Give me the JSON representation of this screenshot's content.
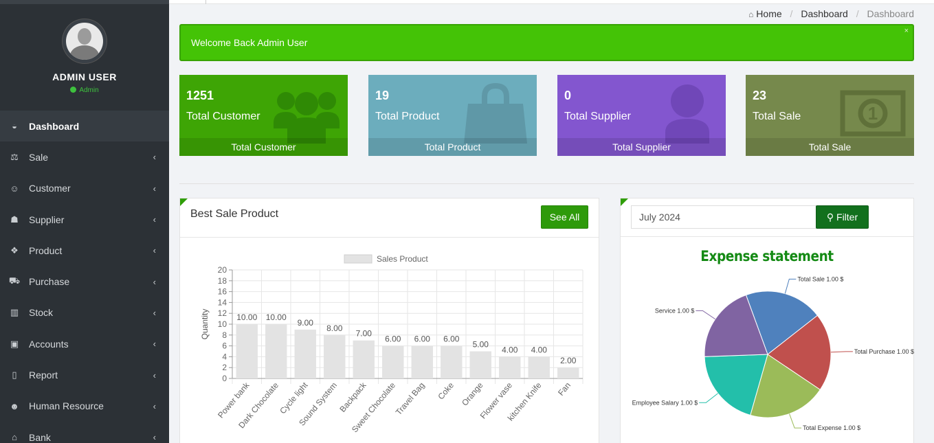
{
  "user": {
    "name": "ADMIN USER",
    "role": "Admin"
  },
  "menu": [
    {
      "label": "Dashboard",
      "icon": "dashboard-icon",
      "glyph": "◒"
    },
    {
      "label": "Sale",
      "icon": "balance-scale-icon",
      "glyph": "⚖"
    },
    {
      "label": "Customer",
      "icon": "user-circle-icon",
      "glyph": "☺"
    },
    {
      "label": "Supplier",
      "icon": "supplier-icon",
      "glyph": "☗"
    },
    {
      "label": "Product",
      "icon": "cubes-icon",
      "glyph": "❖"
    },
    {
      "label": "Purchase",
      "icon": "cart-icon",
      "glyph": "⛟"
    },
    {
      "label": "Stock",
      "icon": "bar-chart-icon",
      "glyph": "▥"
    },
    {
      "label": "Accounts",
      "icon": "money-icon",
      "glyph": "▣"
    },
    {
      "label": "Report",
      "icon": "book-icon",
      "glyph": "▯"
    },
    {
      "label": "Human Resource",
      "icon": "users-icon",
      "glyph": "☻"
    },
    {
      "label": "Bank",
      "icon": "bank-icon",
      "glyph": "⌂"
    }
  ],
  "breadcrumb": {
    "home": "Home",
    "parent": "Dashboard",
    "current": "Dashboard"
  },
  "alert": {
    "text": "Welcome Back Admin User",
    "close": "×"
  },
  "cards": [
    {
      "value": "1251",
      "label": "Total Customer",
      "footer": "Total Customer",
      "icon": "users-icon"
    },
    {
      "value": "19",
      "label": "Total Product",
      "footer": "Total Product",
      "icon": "shopping-bag-icon"
    },
    {
      "value": "0",
      "label": "Total Supplier",
      "footer": "Total Supplier",
      "icon": "user-icon"
    },
    {
      "value": "23",
      "label": "Total Sale",
      "footer": "Total Sale",
      "icon": "money-bill-icon"
    }
  ],
  "best_sale": {
    "title": "Best Sale Product",
    "button": "See All"
  },
  "expense": {
    "month": "July 2024",
    "filter": "Filter",
    "title": "Expense statement"
  },
  "chart_data": [
    {
      "type": "bar",
      "legend": [
        "Sales Product"
      ],
      "ylabel": "Quantity",
      "ylim": [
        0,
        20
      ],
      "yticks": [
        0,
        2,
        4,
        6,
        8,
        10,
        12,
        14,
        16,
        18,
        20
      ],
      "categories": [
        "Power bank",
        "Dark Chocolate",
        "Cycle light",
        "Sound System",
        "Backpack",
        "Sweet Chocolate",
        "Travel Bag",
        "Coke",
        "Orange",
        "Flower vase",
        "kitchen Knife",
        "Fan"
      ],
      "values": [
        10,
        10,
        9,
        8,
        7,
        6,
        6,
        6,
        5,
        4,
        4,
        2
      ],
      "data_labels": [
        "10.00",
        "10.00",
        "9.00",
        "8.00",
        "7.00",
        "6.00",
        "6.00",
        "6.00",
        "5.00",
        "4.00",
        "4.00",
        "2.00"
      ],
      "color": "#e3e3e3"
    },
    {
      "type": "pie",
      "title": "Expense statement",
      "slices": [
        {
          "label": "Total Sale 1.00 $",
          "value": 1,
          "color": "#4f81bd"
        },
        {
          "label": "Total Purchase 1.00 $",
          "value": 1,
          "color": "#c0504d"
        },
        {
          "label": "Total Expense 1.00 $",
          "value": 1,
          "color": "#9bbb59"
        },
        {
          "label": "Employee Salary 1.00 $",
          "value": 1,
          "color": "#23bfaa"
        },
        {
          "label": "Service  1.00 $",
          "value": 1,
          "color": "#8064a2"
        }
      ]
    }
  ]
}
